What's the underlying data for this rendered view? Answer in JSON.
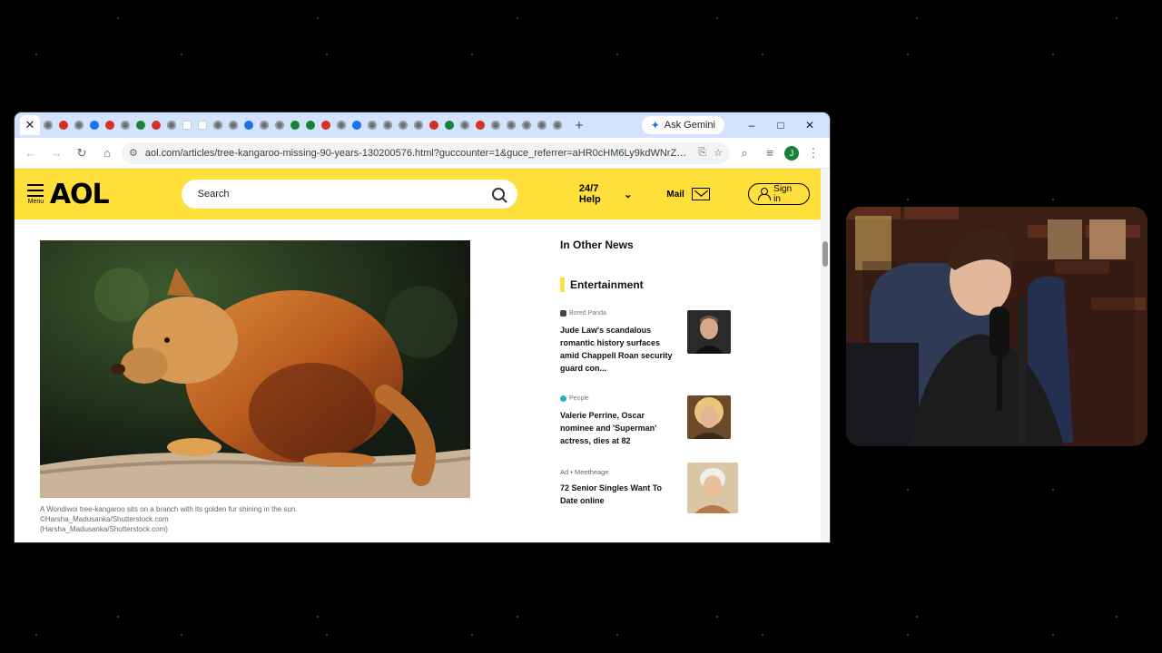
{
  "browser": {
    "tabs_favicon_count": 34,
    "ask_gemini": "Ask Gemini",
    "new_tab": "+",
    "url": "aol.com/articles/tree-kangaroo-missing-90-years-130200576.html?guccounter=1&guce_referrer=aHR0cHM6Ly9kdWNrZHVja2dvLmN...",
    "profile_initial": "J",
    "window_controls": {
      "minimize": "–",
      "maximize": "□",
      "close": "✕"
    }
  },
  "aol": {
    "menu_label": "Menu",
    "logo": "AOL",
    "search_placeholder": "Search",
    "help_label": "24/7 Help",
    "mail_label": "Mail",
    "signin_label": "Sign in",
    "brand_yellow": "#ffe03b"
  },
  "article": {
    "image_alt": "tree-kangaroo",
    "caption_lines": [
      "A Wondiwoi tree-kangaroo sits on a branch with its golden fur shining in the sun.",
      "©Harsha_Madusanka/Shutterstock.com",
      "(Harsha_Madusanka/Shutterstock.com)"
    ]
  },
  "sidebar": {
    "heading": "In Other News",
    "section": "Entertainment",
    "items": [
      {
        "source": "Bored Panda",
        "headline": "Jude Law's scandalous romantic history surfaces amid Chappell Roan security guard con..."
      },
      {
        "source": "People",
        "headline": "Valerie Perrine, Oscar nominee and 'Superman' actress, dies at 82"
      },
      {
        "source": "Ad • Meetheage",
        "headline": "72 Senior Singles Want To Date online"
      }
    ]
  }
}
